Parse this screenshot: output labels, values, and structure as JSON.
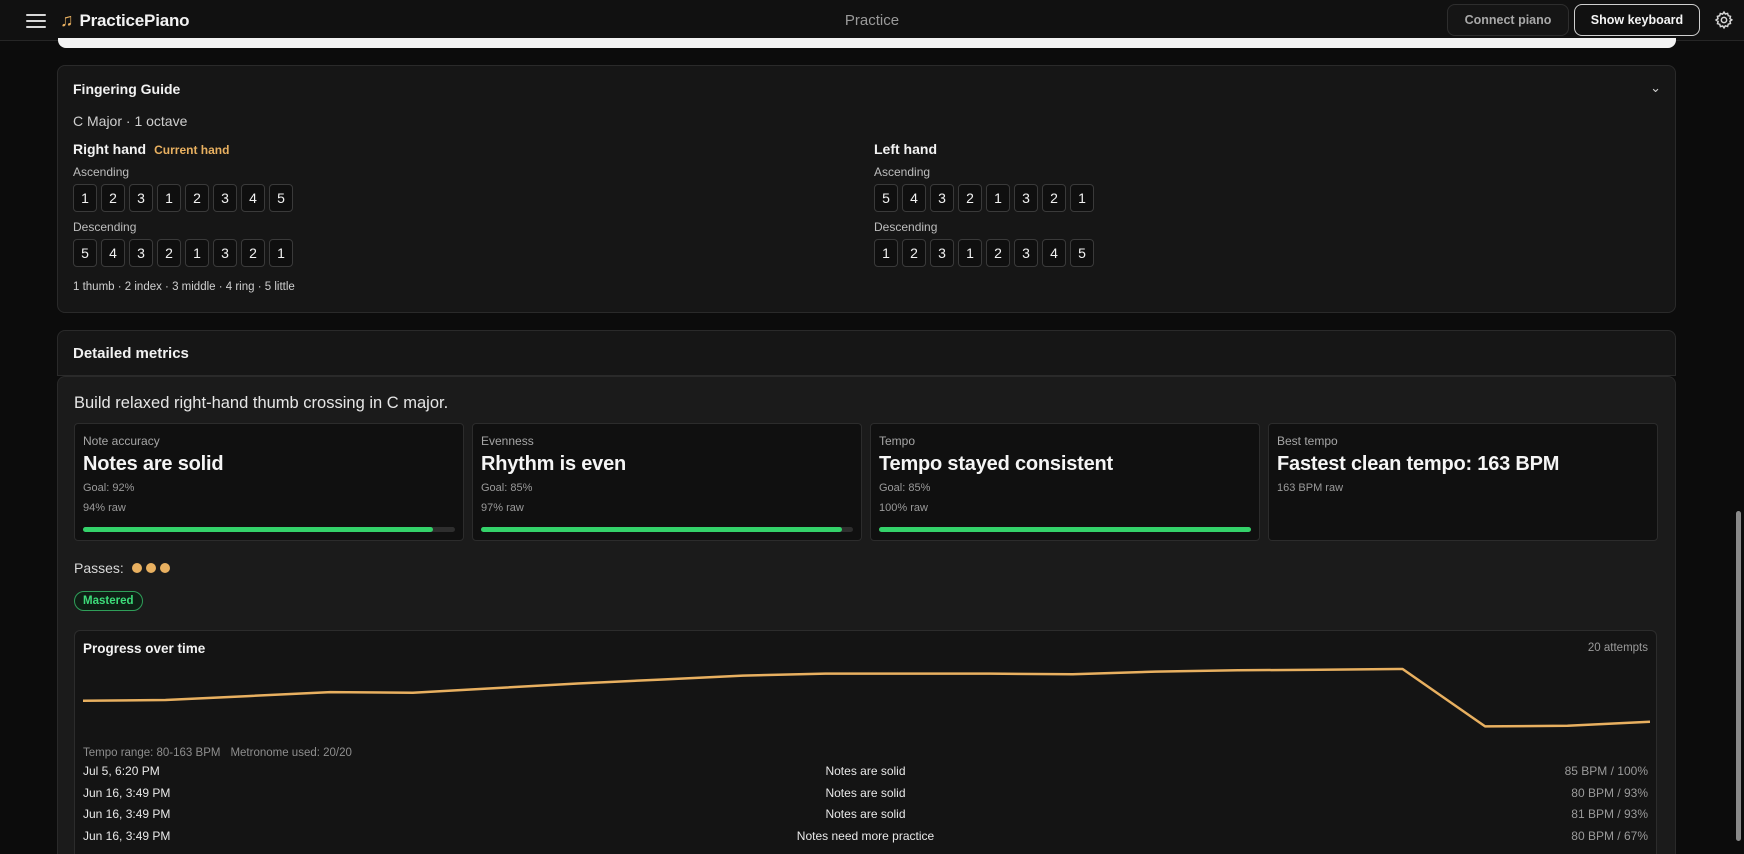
{
  "app": {
    "name": "PracticePiano",
    "page_title": "Practice"
  },
  "header": {
    "connect_label": "Connect piano",
    "keyboard_label": "Show keyboard"
  },
  "fingering": {
    "title": "Fingering Guide",
    "subtitle": "C Major · 1 octave",
    "right": {
      "title": "Right hand",
      "badge": "Current hand",
      "asc_label": "Ascending",
      "asc": [
        "1",
        "2",
        "3",
        "1",
        "2",
        "3",
        "4",
        "5"
      ],
      "desc_label": "Descending",
      "desc": [
        "5",
        "4",
        "3",
        "2",
        "1",
        "3",
        "2",
        "1"
      ]
    },
    "left": {
      "title": "Left hand",
      "asc_label": "Ascending",
      "asc": [
        "5",
        "4",
        "3",
        "2",
        "1",
        "3",
        "2",
        "1"
      ],
      "desc_label": "Descending",
      "desc": [
        "1",
        "2",
        "3",
        "1",
        "2",
        "3",
        "4",
        "5"
      ]
    },
    "legend": "1 thumb · 2 index · 3 middle · 4 ring · 5 little"
  },
  "metrics": {
    "title": "Detailed metrics",
    "goal": "Build relaxed right-hand thumb crossing in C major.",
    "tiles": [
      {
        "label": "Note accuracy",
        "headline": "Notes are solid",
        "goal": "Goal: 92%",
        "raw": "94% raw",
        "progress": 0.94
      },
      {
        "label": "Evenness",
        "headline": "Rhythm is even",
        "goal": "Goal: 85%",
        "raw": "97% raw",
        "progress": 0.97
      },
      {
        "label": "Tempo",
        "headline": "Tempo stayed consistent",
        "goal": "Goal: 85%",
        "raw": "100% raw",
        "progress": 1.0
      },
      {
        "label": "Best tempo",
        "headline": "Fastest clean tempo: 163 BPM",
        "raw": "163 BPM raw"
      }
    ],
    "passes_label": "Passes:",
    "passes_count": 3,
    "badge": "Mastered",
    "progress": {
      "title": "Progress over time",
      "attempts": "20 attempts",
      "tempo_range": "Tempo range: 80-163 BPM",
      "metronome": "Metronome used: 20/20",
      "rows": [
        {
          "date": "Jul 5, 6:20 PM",
          "msg": "Notes are solid",
          "val": "85 BPM / 100%"
        },
        {
          "date": "Jun 16, 3:49 PM",
          "msg": "Notes are solid",
          "val": "80 BPM / 93%"
        },
        {
          "date": "Jun 16, 3:49 PM",
          "msg": "Notes are solid",
          "val": "81 BPM / 93%"
        },
        {
          "date": "Jun 16, 3:49 PM",
          "msg": "Notes need more practice",
          "val": "80 BPM / 67%"
        }
      ]
    }
  },
  "chart_data": {
    "type": "line",
    "x": [
      1,
      2,
      3,
      4,
      5,
      6,
      7,
      8,
      9,
      10,
      11,
      12,
      13,
      14,
      15,
      16,
      17,
      18,
      19,
      20
    ],
    "y": [
      0.52,
      0.53,
      0.59,
      0.65,
      0.64,
      0.71,
      0.78,
      0.84,
      0.9,
      0.93,
      0.93,
      0.93,
      0.92,
      0.96,
      0.98,
      0.99,
      1.0,
      0.13,
      0.14,
      0.2
    ],
    "series_color": "#e8b060",
    "grid": false
  },
  "colors": {
    "accent": "#e8b060",
    "success": "#34d26a"
  }
}
